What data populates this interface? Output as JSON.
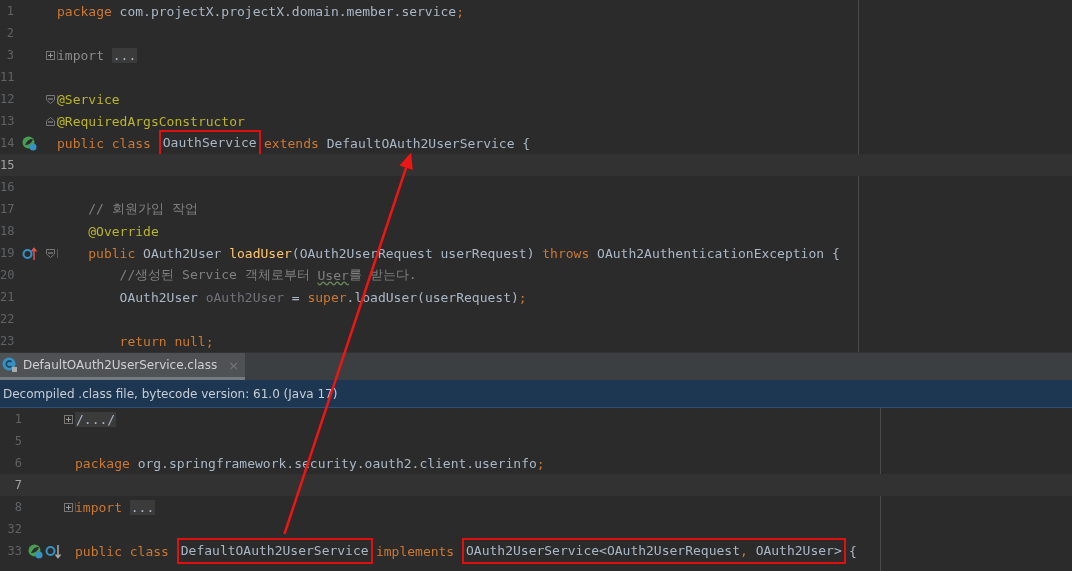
{
  "top_editor": {
    "lines": [
      {
        "number": "1",
        "tokens": [
          {
            "kind": "keyword",
            "text": "package"
          },
          {
            "kind": "plain",
            "text": " com.projectX.projectX.domain.member.service"
          },
          {
            "kind": "keyword",
            "text": ";"
          }
        ]
      },
      {
        "number": "2"
      },
      {
        "number": "3",
        "fold": {
          "kind": "expand"
        },
        "tokens": [
          {
            "kind": "dim",
            "text": "import"
          },
          {
            "kind": "folded",
            "text": "...",
            "spaced": true
          }
        ]
      },
      {
        "number": "11"
      },
      {
        "number": "12",
        "fold": {
          "kind": "collapse"
        },
        "tokens": [
          {
            "kind": "annotation",
            "text": "@Service"
          }
        ]
      },
      {
        "number": "13",
        "fold": {
          "kind": "end"
        },
        "tokens": [
          {
            "kind": "annotation",
            "text": "@RequiredArgsConstructor"
          }
        ]
      },
      {
        "number": "14",
        "icons": [
          {
            "kind": "implemented"
          }
        ],
        "tokens": [
          {
            "kind": "keyword",
            "text": "public class"
          },
          {
            "kind": "plain",
            "text": "OauthService",
            "boxed": true,
            "spaced": true
          },
          {
            "kind": "keyword",
            "text": "extends",
            "spaced": true
          },
          {
            "kind": "plain",
            "text": "DefaultOAuth2UserService",
            "arrow_end": true,
            "spaced": true
          },
          {
            "kind": "plain",
            "text": "{",
            "spaced": true
          }
        ]
      },
      {
        "number": "15",
        "current": true
      },
      {
        "number": "16"
      },
      {
        "number": "17",
        "kind": "member",
        "tokens": [
          {
            "kind": "comment",
            "text": "// 회원가입 작업"
          }
        ]
      },
      {
        "number": "18",
        "kind": "member",
        "tokens": [
          {
            "kind": "annotation",
            "text": "@Override"
          }
        ]
      },
      {
        "number": "19",
        "kind": "member",
        "icons": [
          {
            "kind": "override"
          }
        ],
        "fold": {
          "kind": "collapse"
        },
        "tokens": [
          {
            "kind": "keyword",
            "text": "public"
          },
          {
            "kind": "plain",
            "text": "OAuth2User",
            "spaced": true
          },
          {
            "kind": "method",
            "text": "loadUser",
            "spaced": true
          },
          {
            "kind": "plain",
            "text": "(OAuth2UserRequest userRequest)"
          },
          {
            "kind": "keyword",
            "text": "throws",
            "spaced": true
          },
          {
            "kind": "plain",
            "text": "OAuth2AuthenticationException {",
            "spaced": true
          }
        ]
      },
      {
        "number": "20",
        "kind": "statement",
        "tokens": [
          {
            "kind": "comment",
            "text": "//생성된 Service 객체로부터"
          },
          {
            "kind": "typo",
            "text": "User",
            "spaced": true
          },
          {
            "kind": "comment",
            "text": "를 받는다."
          }
        ]
      },
      {
        "number": "21",
        "kind": "statement",
        "tokens": [
          {
            "kind": "plain",
            "text": "OAuth2User"
          },
          {
            "kind": "unused",
            "text": "oAuth2User",
            "spaced": true
          },
          {
            "kind": "plain",
            "text": "=",
            "spaced": true
          },
          {
            "kind": "keyword",
            "text": "super",
            "spaced": true
          },
          {
            "kind": "plain",
            "text": ".loadUser(userRequest)"
          },
          {
            "kind": "keyword",
            "text": ";"
          }
        ]
      },
      {
        "number": "22"
      },
      {
        "number": "23",
        "kind": "statement",
        "tokens": [
          {
            "kind": "keyword",
            "text": "return null;"
          }
        ]
      }
    ]
  },
  "tab": {
    "label": "DefaultOAuth2UserService.class",
    "selected": true,
    "close": "×"
  },
  "banner": "Decompiled .class file, bytecode version: 61.0 (Java 17)",
  "bottom_editor": {
    "lines": [
      {
        "number": "1",
        "fold": {
          "kind": "expand"
        },
        "tokens": [
          {
            "kind": "folded",
            "text": "/.../"
          }
        ]
      },
      {
        "number": "5"
      },
      {
        "number": "6",
        "tokens": [
          {
            "kind": "keyword",
            "text": "package"
          },
          {
            "kind": "plain",
            "text": "org.springframework.security.oauth2.client.userinfo",
            "spaced": true
          },
          {
            "kind": "keyword",
            "text": ";"
          }
        ]
      },
      {
        "number": "7",
        "current": true
      },
      {
        "number": "8",
        "fold": {
          "kind": "expand"
        },
        "tokens": [
          {
            "kind": "keyword",
            "text": "import"
          },
          {
            "kind": "folded",
            "text": "...",
            "spaced": true
          }
        ]
      },
      {
        "number": "32"
      },
      {
        "number": "33",
        "icons": [
          {
            "kind": "implemented"
          },
          {
            "kind": "implementation"
          }
        ],
        "tokens": [
          {
            "kind": "keyword",
            "text": "public class"
          },
          {
            "kind": "plain",
            "text": "DefaultOAuth2UserService",
            "boxed": true,
            "arrow_start": true,
            "spaced": true
          },
          {
            "kind": "keyword",
            "text": "implements",
            "spaced": true
          },
          {
            "kind": "group",
            "boxed": true,
            "spaced": true,
            "parts": [
              {
                "kind": "plain",
                "text": "OAuth2UserService<OAuth2UserRequest"
              },
              {
                "kind": "keyword",
                "text": ","
              },
              {
                "kind": "plain",
                "text": "OAuth2User>",
                "spaced": true
              }
            ]
          },
          {
            "kind": "plain",
            "text": "{",
            "spaced": true
          }
        ]
      }
    ]
  }
}
